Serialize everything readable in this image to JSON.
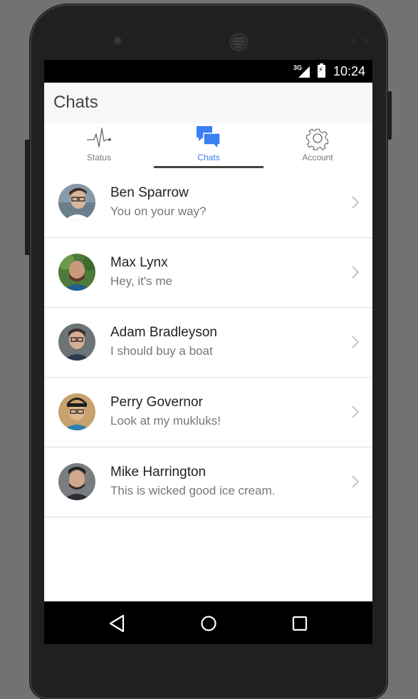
{
  "status_bar": {
    "network": "3G",
    "time": "10:24"
  },
  "app": {
    "title": "Chats"
  },
  "tabs": [
    {
      "label": "Status",
      "icon": "pulse-icon",
      "active": false
    },
    {
      "label": "Chats",
      "icon": "chat-bubbles-icon",
      "active": true
    },
    {
      "label": "Account",
      "icon": "gear-icon",
      "active": false
    }
  ],
  "chats": [
    {
      "name": "Ben Sparrow",
      "message": "You on your way?",
      "avatar": "avatar-ben-sparrow"
    },
    {
      "name": "Max Lynx",
      "message": "Hey, it's me",
      "avatar": "avatar-max-lynx"
    },
    {
      "name": "Adam Bradleyson",
      "message": "I should buy a boat",
      "avatar": "avatar-adam-bradleyson"
    },
    {
      "name": "Perry Governor",
      "message": "Look at my mukluks!",
      "avatar": "avatar-perry-governor"
    },
    {
      "name": "Mike Harrington",
      "message": "This is wicked good ice cream.",
      "avatar": "avatar-mike-harrington"
    }
  ],
  "nav_bar": {
    "back": "back-triangle-icon",
    "home": "home-circle-icon",
    "recent": "recent-apps-square-icon"
  },
  "colors": {
    "accent": "#387ef5",
    "status_bar": "#000000",
    "app_bar": "#f7f7f7",
    "device": "#202020"
  }
}
